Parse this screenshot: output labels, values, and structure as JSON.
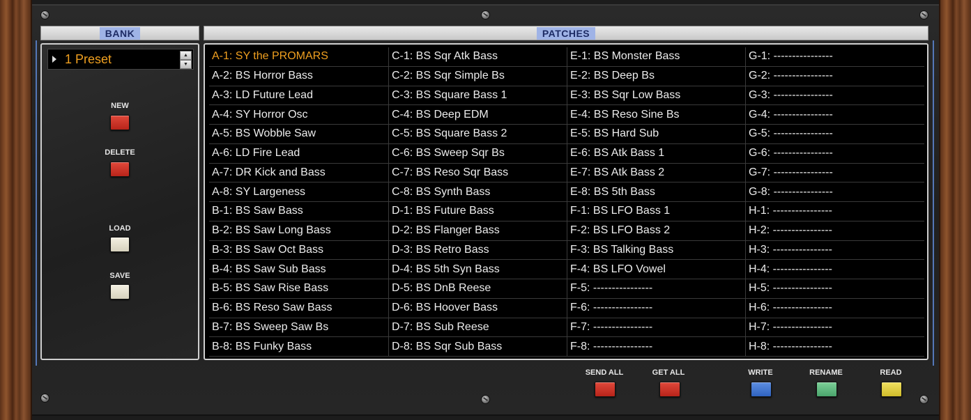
{
  "bank": {
    "header": "BANK",
    "selected": "1 Preset",
    "new_label": "NEW",
    "delete_label": "DELETE",
    "load_label": "LOAD",
    "save_label": "SAVE"
  },
  "patches": {
    "header": "PATCHES",
    "selected": "A-1",
    "columns": [
      [
        "A-1: SY the PROMARS",
        "A-2: BS Horror Bass",
        "A-3: LD Future Lead",
        "A-4: SY Horror Osc",
        "A-5: BS Wobble Saw",
        "A-6: LD Fire Lead",
        "A-7: DR Kick and Bass",
        "A-8: SY Largeness",
        "B-1: BS Saw Bass",
        "B-2: BS Saw Long Bass",
        "B-3: BS Saw Oct Bass",
        "B-4: BS Saw Sub Bass",
        "B-5: BS Saw Rise Bass",
        "B-6: BS Reso Saw Bass",
        "B-7: BS Sweep Saw Bs",
        "B-8: BS Funky Bass"
      ],
      [
        "C-1: BS Sqr Atk Bass",
        "C-2: BS Sqr Simple Bs",
        "C-3: BS Square Bass 1",
        "C-4: BS Deep EDM",
        "C-5: BS Square Bass 2",
        "C-6: BS Sweep Sqr Bs",
        "C-7: BS Reso Sqr Bass",
        "C-8: BS Synth Bass",
        "D-1: BS Future Bass",
        "D-2: BS Flanger Bass",
        "D-3: BS Retro Bass",
        "D-4: BS 5th Syn Bass",
        "D-5: BS DnB Reese",
        "D-6: BS Hoover Bass",
        "D-7: BS Sub Reese",
        "D-8: BS Sqr Sub Bass"
      ],
      [
        "E-1: BS Monster Bass",
        "E-2: BS Deep Bs",
        "E-3: BS Sqr Low Bass",
        "E-4: BS Reso Sine Bs",
        "E-5: BS Hard Sub",
        "E-6: BS Atk Bass 1",
        "E-7: BS Atk Bass 2",
        "E-8: BS 5th Bass",
        "F-1: BS LFO Bass 1",
        "F-2: BS LFO Bass 2",
        "F-3: BS Talking Bass",
        "F-4: BS LFO Vowel",
        "F-5: ----------------",
        "F-6: ----------------",
        "F-7: ----------------",
        "F-8: ----------------"
      ],
      [
        "G-1: ----------------",
        "G-2: ----------------",
        "G-3: ----------------",
        "G-4: ----------------",
        "G-5: ----------------",
        "G-6: ----------------",
        "G-7: ----------------",
        "G-8: ----------------",
        "H-1: ----------------",
        "H-2: ----------------",
        "H-3: ----------------",
        "H-4: ----------------",
        "H-5: ----------------",
        "H-6: ----------------",
        "H-7: ----------------",
        "H-8: ----------------"
      ]
    ]
  },
  "actions": {
    "send_all_label": "SEND ALL",
    "get_all_label": "GET ALL",
    "write_label": "WRITE",
    "rename_label": "RENAME",
    "read_label": "READ"
  },
  "colors": {
    "selected_text": "#f0a020",
    "header_tag": "#9fb3e6",
    "red_button": "#c8301f",
    "blue_button": "#3f72cc",
    "green_button": "#5db67d",
    "yellow_button": "#dccb3a",
    "cream_button": "#e8e3d0"
  }
}
